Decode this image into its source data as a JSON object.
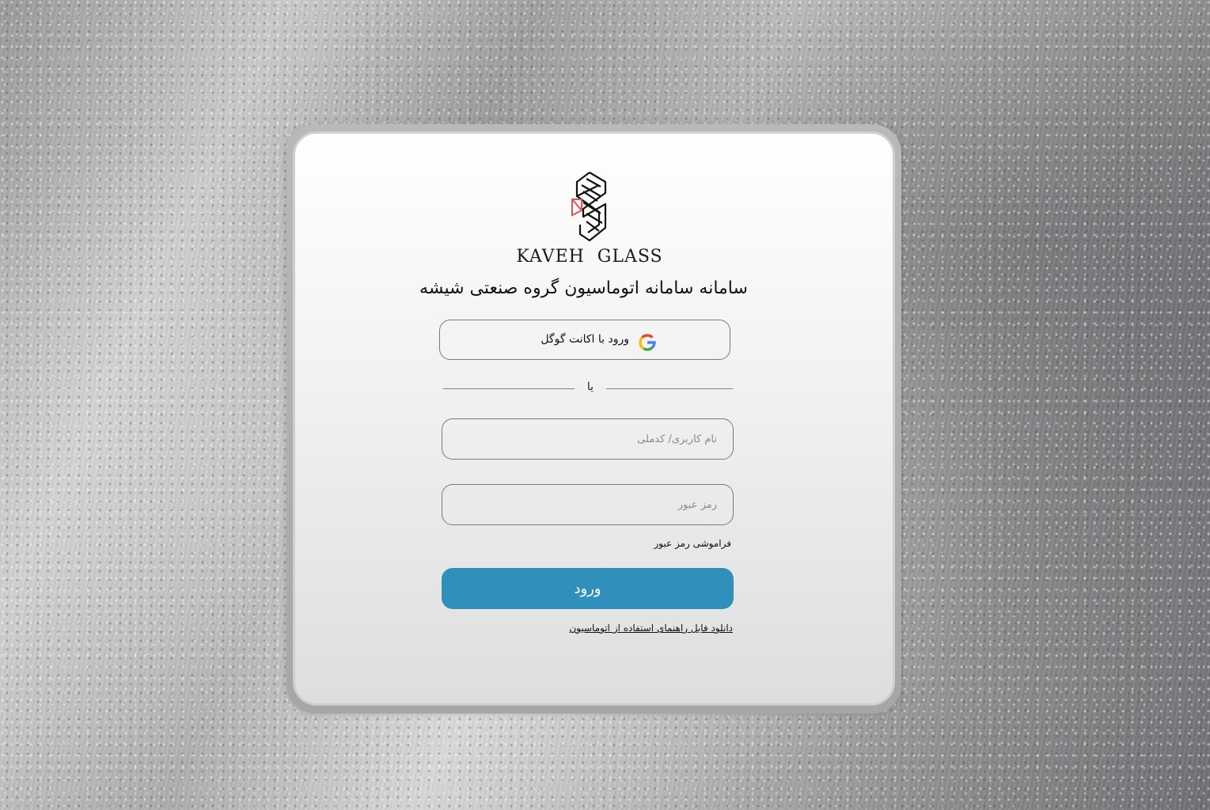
{
  "brand": {
    "name": "KAVEH  GLASS",
    "logo_icon": "kaveh-glass-logo"
  },
  "login": {
    "title": "سامانه سامانه اتوماسیون گروه صنعتی شیشه",
    "google_button_label": "ورود با اکانت گوگل",
    "google_icon": "google-icon",
    "divider_text": "یا",
    "username_placeholder": "نام کاربری/ کدملی",
    "password_placeholder": "رمز عبور",
    "forgot_password": "فراموشی رمز عبور",
    "submit_label": "ورود",
    "manual_link": "دانلود فایل راهنمای استفاده از اتوماسیون"
  },
  "colors": {
    "primary_button": "#3190bb",
    "logo_accent": "#e0505a"
  }
}
